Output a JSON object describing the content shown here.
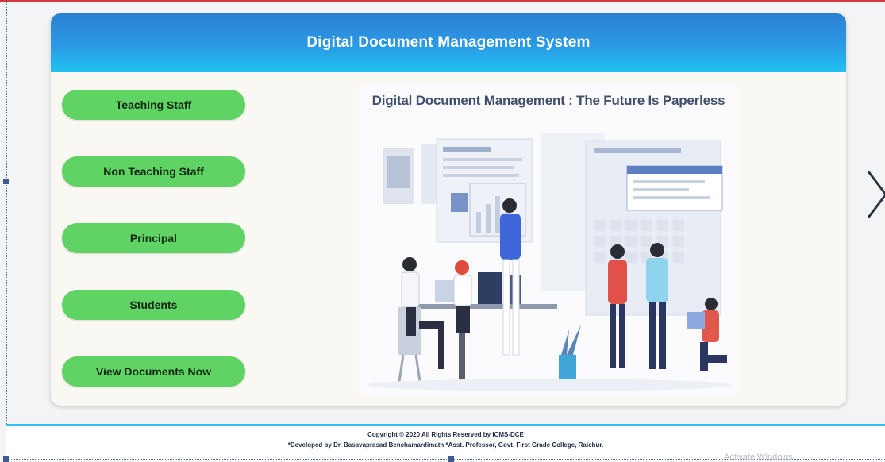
{
  "header": {
    "title": "Digital Document Management System"
  },
  "nav": {
    "items": [
      {
        "label": "Teaching Staff"
      },
      {
        "label": "Non Teaching Staff"
      },
      {
        "label": "Principal"
      },
      {
        "label": "Students"
      },
      {
        "label": "View Documents Now"
      }
    ]
  },
  "hero": {
    "title": "Digital Document Management : The Future Is Paperless"
  },
  "footer": {
    "copyright": "Copyright © 2020 All Rights Reserved by ICMS-DCE",
    "developer": "*Developed by Dr. Basavaprasad Benchamardimath *Asst. Professor, Govt. First Grade College, Raichur."
  },
  "watermark": {
    "text": "Activate Windows"
  },
  "colors": {
    "header_gradient_top": "#2e7fd2",
    "header_gradient_bottom": "#22c1f1",
    "nav_button": "#5fd363",
    "top_rule": "#d6343c",
    "footer_rule": "#2ec4ef"
  },
  "icons": {
    "next": "chevron-right-icon"
  }
}
